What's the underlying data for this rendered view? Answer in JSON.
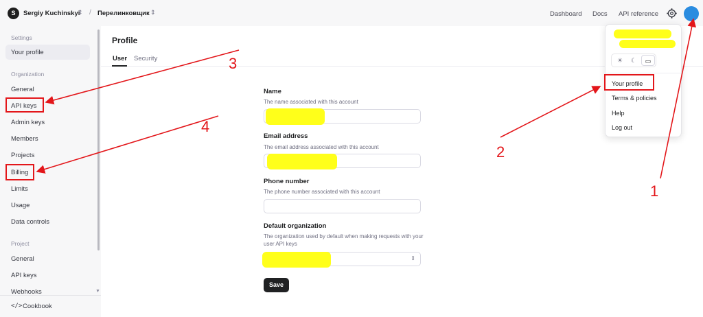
{
  "topbar": {
    "avatar_letter": "S",
    "user_name": "Sergiy Kuchinskyi",
    "separator": "/",
    "org_name": "Перелинковщик",
    "nav": {
      "dashboard": "Dashboard",
      "docs": "Docs",
      "api_reference": "API reference"
    }
  },
  "sidebar": {
    "settings_heading": "Settings",
    "your_profile": "Your profile",
    "organization_heading": "Organization",
    "org_items": [
      "General",
      "API keys",
      "Admin keys",
      "Members",
      "Projects",
      "Billing",
      "Limits",
      "Usage",
      "Data controls"
    ],
    "project_heading": "Project",
    "project_items": [
      "General",
      "API keys",
      "Webhooks"
    ],
    "cookbook_icon": "</>",
    "cookbook": "Cookbook"
  },
  "main": {
    "title": "Profile",
    "tabs": {
      "user": "User",
      "security": "Security"
    },
    "fields": {
      "name_label": "Name",
      "name_help": "The name associated with this account",
      "email_label": "Email address",
      "email_help": "The email address associated with this account",
      "phone_label": "Phone number",
      "phone_help": "The phone number associated with this account",
      "org_label": "Default organization",
      "org_help": "The organization used by default when making requests with your user API keys"
    },
    "save_label": "Save"
  },
  "dropdown": {
    "theme_icons": [
      "sun-icon",
      "moon-icon",
      "monitor-icon"
    ],
    "items": [
      "Your profile",
      "Terms & policies",
      "Help",
      "Log out"
    ]
  },
  "annotations": {
    "one": "1",
    "two": "2",
    "three": "3",
    "four": "4"
  },
  "colors": {
    "annotation_red": "#e3161a",
    "highlight_yellow": "#ffff1a",
    "avatar_blue": "#2a8ce0",
    "button_dark": "#202123"
  }
}
